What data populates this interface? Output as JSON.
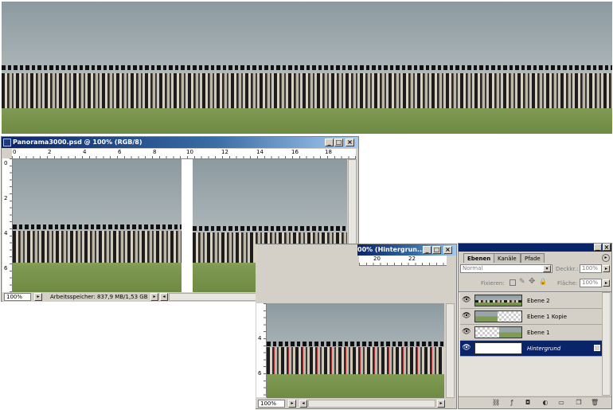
{
  "doc_window": {
    "title": "Panorama3000.psd @ 100% (RGB/8)",
    "zoom": "100%",
    "status": "Arbeitsspeicher: 837,9 MB/1,53 GB",
    "ruler_h": [
      "0",
      "2",
      "4",
      "6",
      "8",
      "10",
      "12",
      "14",
      "16",
      "18"
    ],
    "ruler_v": [
      "0",
      "2",
      "4",
      "6"
    ]
  },
  "second_window": {
    "title": "00% (Hintergrun...",
    "zoom": "100%",
    "ruler_h": [
      "20",
      "22"
    ],
    "ruler_v": [
      "4",
      "6"
    ]
  },
  "layers_panel": {
    "tabs": [
      "Ebenen",
      "Kanäle",
      "Pfade"
    ],
    "blend_mode": "Normal",
    "opacity_label": "Deckkr.:",
    "opacity": "100%",
    "lock_label": "Fixieren:",
    "fill_label": "Fläche:",
    "fill": "100%",
    "layers": [
      {
        "name": "Ebene 2",
        "selected": false
      },
      {
        "name": "Ebene 1 Kopie",
        "selected": false
      },
      {
        "name": "Ebene 1",
        "selected": false
      },
      {
        "name": "Hintergrund",
        "selected": true
      }
    ]
  },
  "icons": {
    "eye": "eye-icon",
    "lock": "lock-icon",
    "move": "move-icon",
    "brush": "brush-icon",
    "new_layer": "new-layer-icon",
    "trash": "trash-icon",
    "link": "link-icon",
    "fx": "fx-icon",
    "mask": "mask-icon",
    "adjust": "adjustment-icon",
    "folder": "folder-icon",
    "panel_menu": "panel-menu-icon"
  },
  "colors": {
    "titlebar": "#0a246a",
    "selection": "#0a246a",
    "chrome": "#d4d0c8"
  }
}
